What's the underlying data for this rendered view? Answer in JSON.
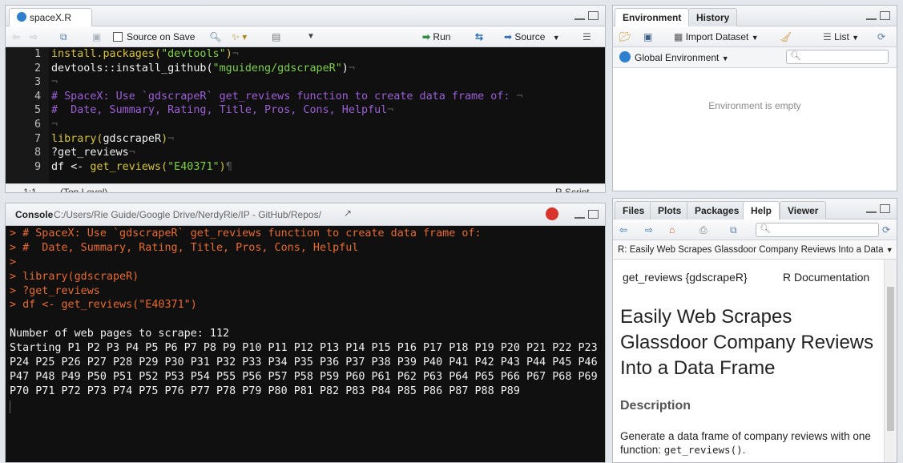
{
  "editor": {
    "file_tab": "spaceX.R",
    "source_on_save": "Source on Save",
    "run_label": "Run",
    "source_label": "Source",
    "line_numbers": [
      "1",
      "2",
      "3",
      "4",
      "5",
      "6",
      "7",
      "8",
      "9"
    ],
    "lines": [
      [
        {
          "t": "install.packages(",
          "c": "kw"
        },
        {
          "t": "\"devtools\"",
          "c": "str"
        },
        {
          "t": ")",
          "c": "kw"
        },
        {
          "t": "¬",
          "c": "inv"
        }
      ],
      [
        {
          "t": "devtools::install_github(",
          "c": ""
        },
        {
          "t": "\"mguideng/gdscrapeR\"",
          "c": "str"
        },
        {
          "t": ")",
          "c": ""
        },
        {
          "t": "¬",
          "c": "inv"
        }
      ],
      [
        {
          "t": "¬",
          "c": "inv"
        }
      ],
      [
        {
          "t": "# SpaceX: Use `gdscrapeR` get_reviews function to create data frame of: ",
          "c": "cm"
        },
        {
          "t": "¬",
          "c": "inv"
        }
      ],
      [
        {
          "t": "#  Date, Summary, Rating, Title, Pros, Cons, Helpful",
          "c": "cm"
        },
        {
          "t": "¬",
          "c": "inv"
        }
      ],
      [
        {
          "t": "¬",
          "c": "inv"
        }
      ],
      [
        {
          "t": "library(",
          "c": "kw"
        },
        {
          "t": "gdscrapeR",
          "c": ""
        },
        {
          "t": ")",
          "c": "kw"
        },
        {
          "t": "¬",
          "c": "inv"
        }
      ],
      [
        {
          "t": "?get_reviews",
          "c": ""
        },
        {
          "t": "¬",
          "c": "inv"
        }
      ],
      [
        {
          "t": "df <- ",
          "c": ""
        },
        {
          "t": "get_reviews(",
          "c": "kw"
        },
        {
          "t": "\"E40371\"",
          "c": "str"
        },
        {
          "t": ")",
          "c": "kw"
        },
        {
          "t": "¶",
          "c": "inv"
        }
      ]
    ],
    "status_pos": "1:1",
    "status_scope": "(Top Level) ⌄",
    "status_type": "R Script ⌄"
  },
  "console": {
    "tab": "Console",
    "path": "C:/Users/Rie Guide/Google Drive/NerdyRie/IP - GitHub/Repos/",
    "lines": [
      {
        "t": "> # SpaceX: Use `gdscrapeR` get_reviews function to create data frame of:",
        "in": true
      },
      {
        "t": "> #  Date, Summary, Rating, Title, Pros, Cons, Helpful",
        "in": true
      },
      {
        "t": ">",
        "in": true
      },
      {
        "t": "> library(gdscrapeR)",
        "in": true
      },
      {
        "t": "> ?get_reviews",
        "in": true
      },
      {
        "t": "> df <- get_reviews(\"E40371\")",
        "in": true
      },
      {
        "t": "",
        "in": false
      },
      {
        "t": "Number of web pages to scrape: 112",
        "in": false
      },
      {
        "t": "Starting P1 P2 P3 P4 P5 P6 P7 P8 P9 P10 P11 P12 P13 P14 P15 P16 P17 P18 P19 P20 P21 P22 P23",
        "in": false
      },
      {
        "t": "P24 P25 P26 P27 P28 P29 P30 P31 P32 P33 P34 P35 P36 P37 P38 P39 P40 P41 P42 P43 P44 P45 P46",
        "in": false
      },
      {
        "t": "P47 P48 P49 P50 P51 P52 P53 P54 P55 P56 P57 P58 P59 P60 P61 P62 P63 P64 P65 P66 P67 P68 P69",
        "in": false
      },
      {
        "t": "P70 P71 P72 P73 P74 P75 P76 P77 P78 P79 P80 P81 P82 P83 P84 P85 P86 P87 P88 P89",
        "in": false
      }
    ]
  },
  "env": {
    "tab_environment": "Environment",
    "tab_history": "History",
    "import_dataset": "Import Dataset",
    "list_view": "List",
    "global_env": "Global Environment",
    "empty_msg": "Environment is empty"
  },
  "help": {
    "tabs": [
      "Files",
      "Plots",
      "Packages",
      "Help",
      "Viewer"
    ],
    "topic_bar": "R: Easily Web Scrapes Glassdoor Company Reviews Into a Data",
    "header_left": "get_reviews {gdscrapeR}",
    "header_right": "R Documentation",
    "title": "Easily Web Scrapes Glassdoor Company Reviews Into a Data Frame",
    "section": "Description",
    "desc_text": "Generate a data frame of company reviews with one function: ",
    "desc_code": "get_reviews()",
    "desc_end": "."
  },
  "colors": {
    "editor_bg": "#101010",
    "keyword": "#d7c43a",
    "string": "#7fd245",
    "comment": "#9c5fd6",
    "console_input": "#ea6a2e",
    "stop_red": "#d9342b"
  }
}
